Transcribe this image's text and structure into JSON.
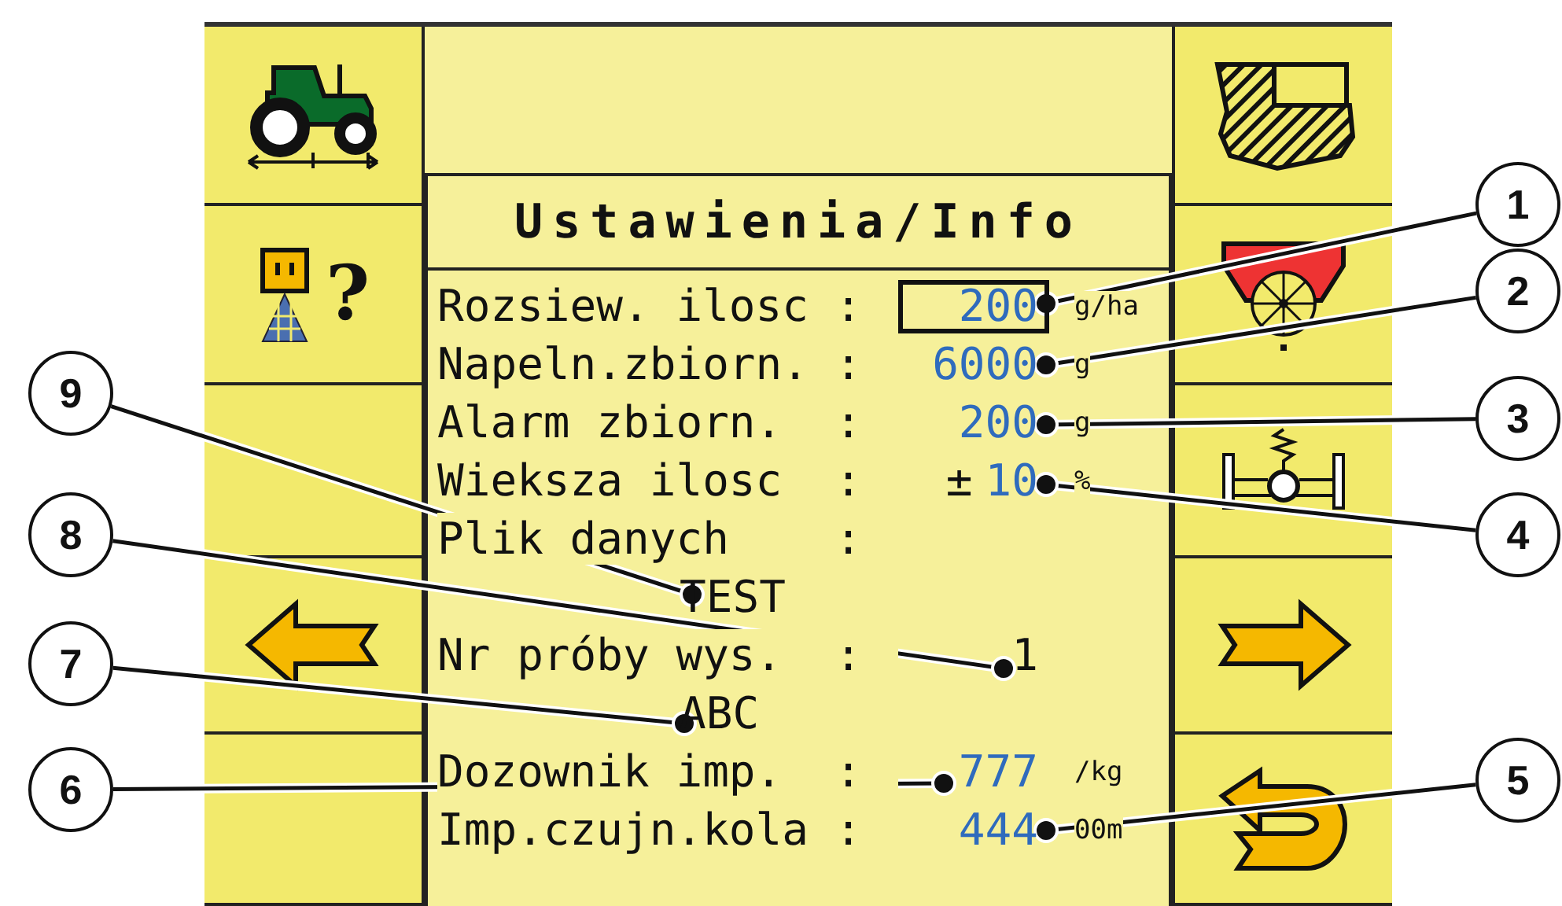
{
  "left_buttons": [
    {
      "kind": "tractor"
    },
    {
      "kind": "sprayer",
      "symbol": "?"
    },
    {
      "kind": "blank"
    },
    {
      "kind": "arrow-left"
    },
    {
      "kind": "blank"
    }
  ],
  "right_buttons": [
    {
      "kind": "field"
    },
    {
      "kind": "spreader"
    },
    {
      "kind": "spring"
    },
    {
      "kind": "arrow-right"
    },
    {
      "kind": "return"
    }
  ],
  "panel": {
    "title": "Ustawienia/Info",
    "rows": [
      {
        "kind": "number",
        "label": "Rozsiew. ilosc :",
        "value": "200",
        "unit": "g/ha",
        "selected": true
      },
      {
        "kind": "number",
        "label": "Napeln.zbiorn. :",
        "value": "6000",
        "unit": "g",
        "selected": false
      },
      {
        "kind": "number",
        "label": "Alarm zbiorn.  :",
        "value": "200",
        "unit": "g",
        "selected": false
      },
      {
        "kind": "number",
        "label": "Wieksza ilosc  :",
        "prefix": "±",
        "value": "10",
        "unit": "%",
        "selected": false
      },
      {
        "kind": "text",
        "label": "Plik danych    :"
      },
      {
        "kind": "detail",
        "value": "TEST"
      },
      {
        "kind": "text",
        "label": "Nr próby wys.  :",
        "value": "1"
      },
      {
        "kind": "detail",
        "value": "ABC"
      },
      {
        "kind": "number",
        "label": "Dozownik imp.  :",
        "value": "777",
        "unit": "/kg",
        "selected": false
      },
      {
        "kind": "number",
        "label": "Imp.czujn.kola :",
        "value": "444",
        "unit": "00m",
        "selected": false
      }
    ]
  },
  "callouts": [
    {
      "number": "9"
    },
    {
      "number": "8"
    },
    {
      "number": "7"
    },
    {
      "number": "6"
    },
    {
      "number": "1"
    },
    {
      "number": "2"
    },
    {
      "number": "3"
    },
    {
      "number": "4"
    },
    {
      "number": "5"
    }
  ]
}
